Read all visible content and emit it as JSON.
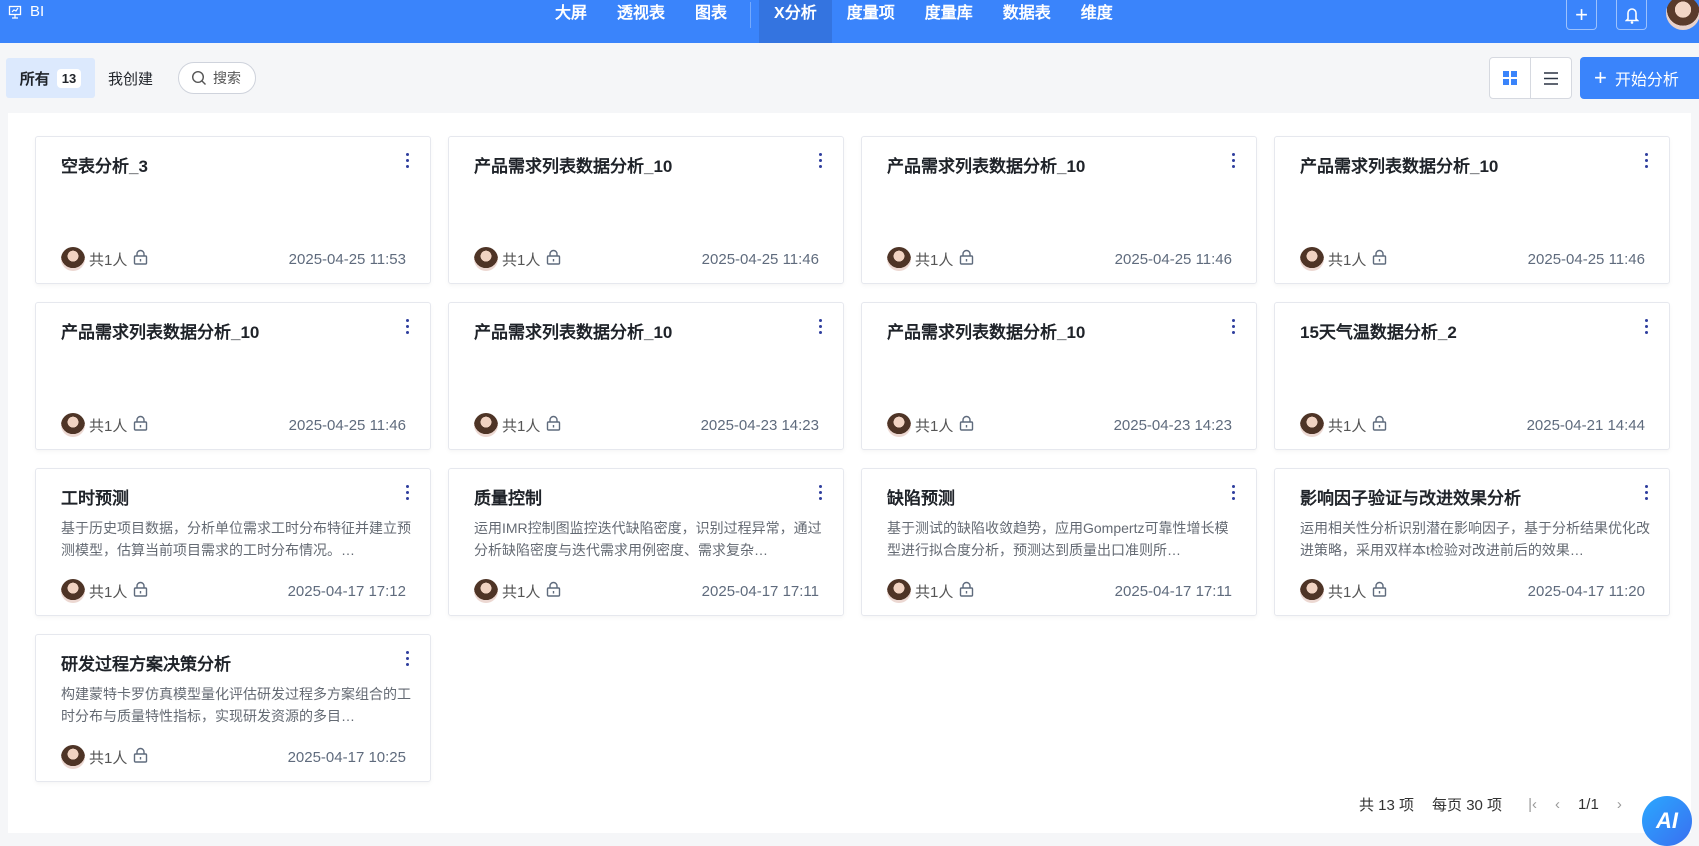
{
  "header": {
    "brand": "BI",
    "nav": [
      "大屏",
      "透视表",
      "图表",
      "X分析",
      "度量项",
      "度量库",
      "数据表",
      "维度"
    ],
    "active": "X分析"
  },
  "toolbar": {
    "tab_all": "所有",
    "tab_all_count": "13",
    "tab_mine": "我创建",
    "search_placeholder": "搜索",
    "start_label": "开始分析"
  },
  "cards": [
    {
      "title": "空表分析_3",
      "desc": "",
      "members": "共1人",
      "date": "2025-04-25 11:53"
    },
    {
      "title": "产品需求列表数据分析_10",
      "desc": "",
      "members": "共1人",
      "date": "2025-04-25 11:46"
    },
    {
      "title": "产品需求列表数据分析_10",
      "desc": "",
      "members": "共1人",
      "date": "2025-04-25 11:46"
    },
    {
      "title": "产品需求列表数据分析_10",
      "desc": "",
      "members": "共1人",
      "date": "2025-04-25 11:46"
    },
    {
      "title": "产品需求列表数据分析_10",
      "desc": "",
      "members": "共1人",
      "date": "2025-04-25 11:46"
    },
    {
      "title": "产品需求列表数据分析_10",
      "desc": "",
      "members": "共1人",
      "date": "2025-04-23 14:23"
    },
    {
      "title": "产品需求列表数据分析_10",
      "desc": "",
      "members": "共1人",
      "date": "2025-04-23 14:23"
    },
    {
      "title": "15天气温数据分析_2",
      "desc": "",
      "members": "共1人",
      "date": "2025-04-21 14:44"
    },
    {
      "title": "工时预测",
      "desc": "基于历史项目数据，分析单位需求工时分布特征并建立预测模型，估算当前项目需求的工时分布情况。…",
      "members": "共1人",
      "date": "2025-04-17 17:12"
    },
    {
      "title": "质量控制",
      "desc": "运用IMR控制图监控迭代缺陷密度，识别过程异常，通过分析缺陷密度与迭代需求用例密度、需求复杂…",
      "members": "共1人",
      "date": "2025-04-17 17:11"
    },
    {
      "title": "缺陷预测",
      "desc": "基于测试的缺陷收敛趋势，应用Gompertz可靠性增长模型进行拟合度分析，预测达到质量出口准则所…",
      "members": "共1人",
      "date": "2025-04-17 17:11"
    },
    {
      "title": "影响因子验证与改进效果分析",
      "desc": "运用相关性分析识别潜在影响因子，基于分析结果优化改进策略，采用双样本t检验对改进前后的效果…",
      "members": "共1人",
      "date": "2025-04-17 11:20"
    },
    {
      "title": "研发过程方案决策分析",
      "desc": "构建蒙特卡罗仿真模型量化评估研发过程多方案组合的工时分布与质量特性指标，实现研发资源的多目…",
      "members": "共1人",
      "date": "2025-04-17 10:25"
    }
  ],
  "pager": {
    "total": "共 13 项",
    "per_page": "每页 30 项",
    "page": "1/1"
  },
  "ai_label": "AI"
}
